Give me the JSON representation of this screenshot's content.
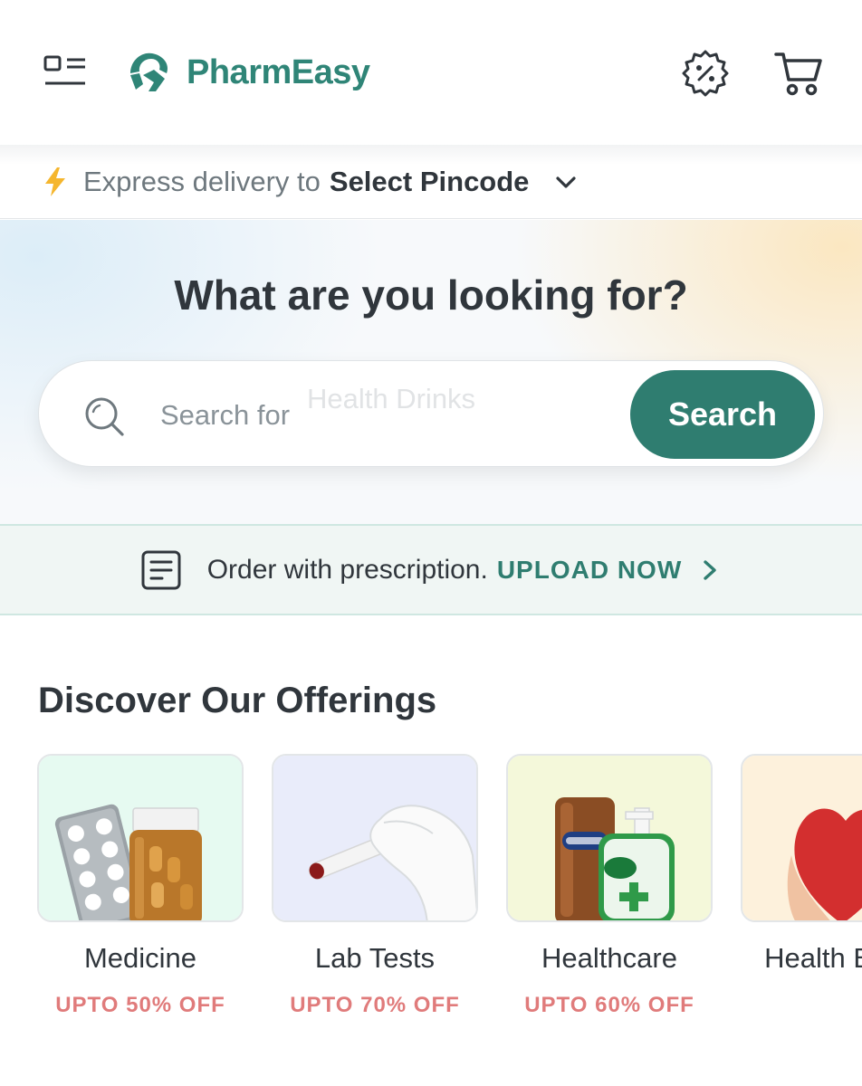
{
  "header": {
    "brand": "PharmEasy",
    "brand_color": "#2f8577",
    "icons": [
      "menu-icon",
      "offers-icon",
      "cart-icon"
    ]
  },
  "delivery": {
    "prefix": "Express delivery to",
    "pincode_label": "Select Pincode"
  },
  "hero": {
    "title": "What are you looking for?",
    "search_placeholder": "Search for",
    "search_rotating_hint": "Health Drinks",
    "search_button": "Search",
    "accent_color": "#2f7d70"
  },
  "prescription": {
    "text": "Order with prescription.",
    "cta": "UPLOAD NOW"
  },
  "offerings": {
    "title": "Discover Our Offerings",
    "cards": [
      {
        "label": "Medicine",
        "offer": "UPTO 50% OFF",
        "bg": "#e6faf1"
      },
      {
        "label": "Lab Tests",
        "offer": "UPTO 70% OFF",
        "bg": "#e9ecfa"
      },
      {
        "label": "Healthcare",
        "offer": "UPTO 60% OFF",
        "bg": "#f4f8da"
      },
      {
        "label": "Health Blogs",
        "offer": "",
        "bg": "#fdf1dc"
      }
    ],
    "offer_color": "#e07b7b"
  }
}
